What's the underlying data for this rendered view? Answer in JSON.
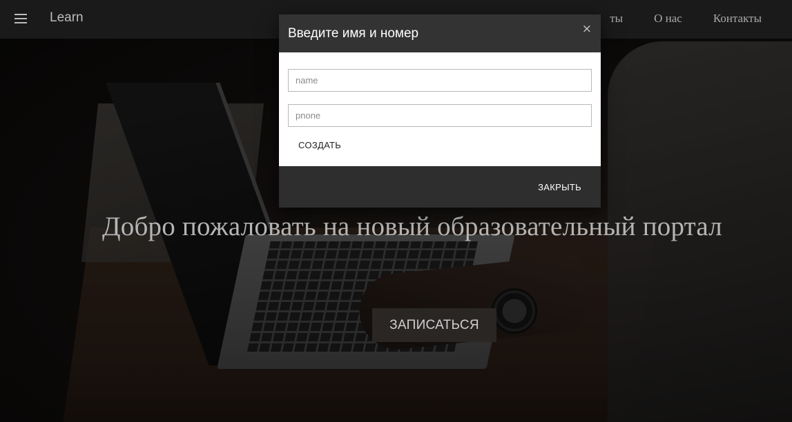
{
  "navbar": {
    "brand": "Learn",
    "links": [
      {
        "label": "ты"
      },
      {
        "label": "О нас"
      },
      {
        "label": "Контакты"
      }
    ]
  },
  "hero": {
    "title": "Добро пожаловать на новый образовательный портал",
    "cta_label": "ЗАПИСАТЬСЯ"
  },
  "modal": {
    "title": "Введите имя и номер",
    "close_icon": "×",
    "name_placeholder": "name",
    "phone_placeholder": "pnone",
    "create_label": "СОЗДАТЬ",
    "close_label": "ЗАКРЫТЬ"
  },
  "icons": {
    "menu": "hamburger-icon",
    "close": "close-icon"
  }
}
